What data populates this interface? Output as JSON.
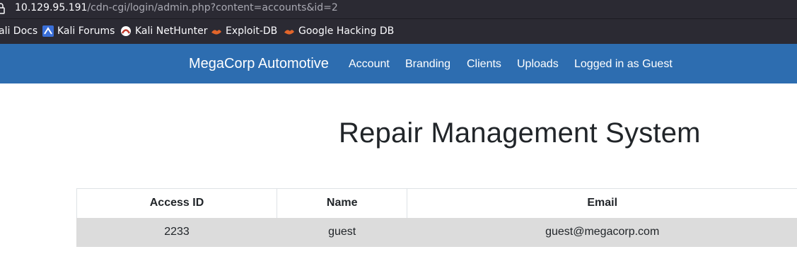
{
  "browser": {
    "url_host": "10.129.95.191",
    "url_path": "/cdn-cgi/login/admin.php?content=accounts&id=2",
    "bookmarks": [
      {
        "label": "ali Docs",
        "icon": "kali-docs-icon"
      },
      {
        "label": "Kali Forums",
        "icon": "kali-forums-icon"
      },
      {
        "label": "Kali NetHunter",
        "icon": "kali-nethunter-icon"
      },
      {
        "label": "Exploit-DB",
        "icon": "exploit-db-icon"
      },
      {
        "label": "Google Hacking DB",
        "icon": "google-hacking-db-icon"
      }
    ]
  },
  "navbar": {
    "brand": "MegaCorp Automotive",
    "links": [
      "Account",
      "Branding",
      "Clients",
      "Uploads",
      "Logged in as Guest"
    ],
    "color": "#2d6db0"
  },
  "page": {
    "title": "Repair Management System"
  },
  "table": {
    "headers": [
      "Access ID",
      "Name",
      "Email"
    ],
    "rows": [
      [
        "2233",
        "guest",
        "guest@megacorp.com"
      ]
    ]
  }
}
